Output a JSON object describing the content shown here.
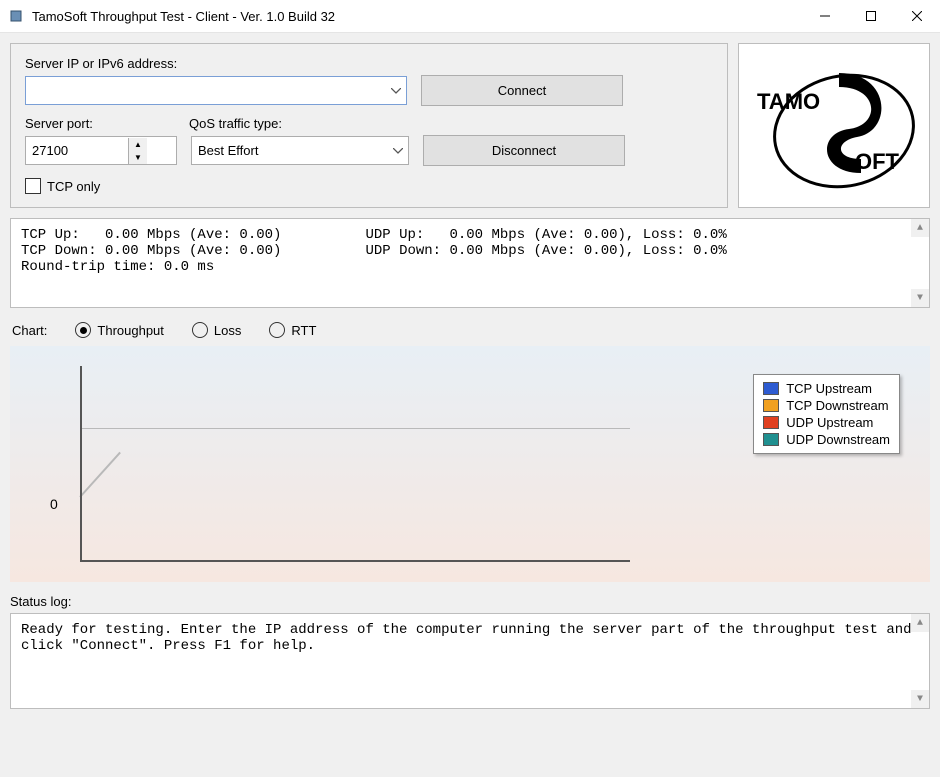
{
  "window": {
    "title": "TamoSoft Throughput Test - Client - Ver. 1.0 Build 32"
  },
  "conn": {
    "ip_label": "Server IP or IPv6  address:",
    "ip_value": "",
    "port_label": "Server port:",
    "port_value": "27100",
    "qos_label": "QoS traffic type:",
    "qos_value": "Best Effort",
    "connect": "Connect",
    "disconnect": "Disconnect",
    "tcp_only": "TCP only"
  },
  "logo": {
    "brand_left": "TAMO",
    "brand_right": "OFT"
  },
  "stats": {
    "line1a": "TCP Up:   0.00 Mbps (Ave: 0.00)",
    "line1b": "UDP Up:   0.00 Mbps (Ave: 0.00), Loss: 0.0%",
    "line2a": "TCP Down: 0.00 Mbps (Ave: 0.00)",
    "line2b": "UDP Down: 0.00 Mbps (Ave: 0.00), Loss: 0.0%",
    "line3": "Round-trip time: 0.0 ms"
  },
  "chart": {
    "label": "Chart:",
    "opt_throughput": "Throughput",
    "opt_loss": "Loss",
    "opt_rtt": "RTT",
    "y0": "0",
    "legend": {
      "tcp_up": {
        "label": "TCP Upstream",
        "color": "#2d5bd1"
      },
      "tcp_down": {
        "label": "TCP Downstream",
        "color": "#f0a020"
      },
      "udp_up": {
        "label": "UDP Upstream",
        "color": "#e04020"
      },
      "udp_down": {
        "label": "UDP Downstream",
        "color": "#209090"
      }
    }
  },
  "chart_data": {
    "type": "line",
    "title": "",
    "xlabel": "",
    "ylabel": "",
    "ylim": [
      0,
      1
    ],
    "x": [],
    "series": [
      {
        "name": "TCP Upstream",
        "values": []
      },
      {
        "name": "TCP Downstream",
        "values": []
      },
      {
        "name": "UDP Upstream",
        "values": []
      },
      {
        "name": "UDP Downstream",
        "values": []
      }
    ]
  },
  "status": {
    "label": "Status log:",
    "text": "Ready for testing. Enter the IP address of the computer running the server part of the throughput test and click \"Connect\". Press F1 for help."
  }
}
